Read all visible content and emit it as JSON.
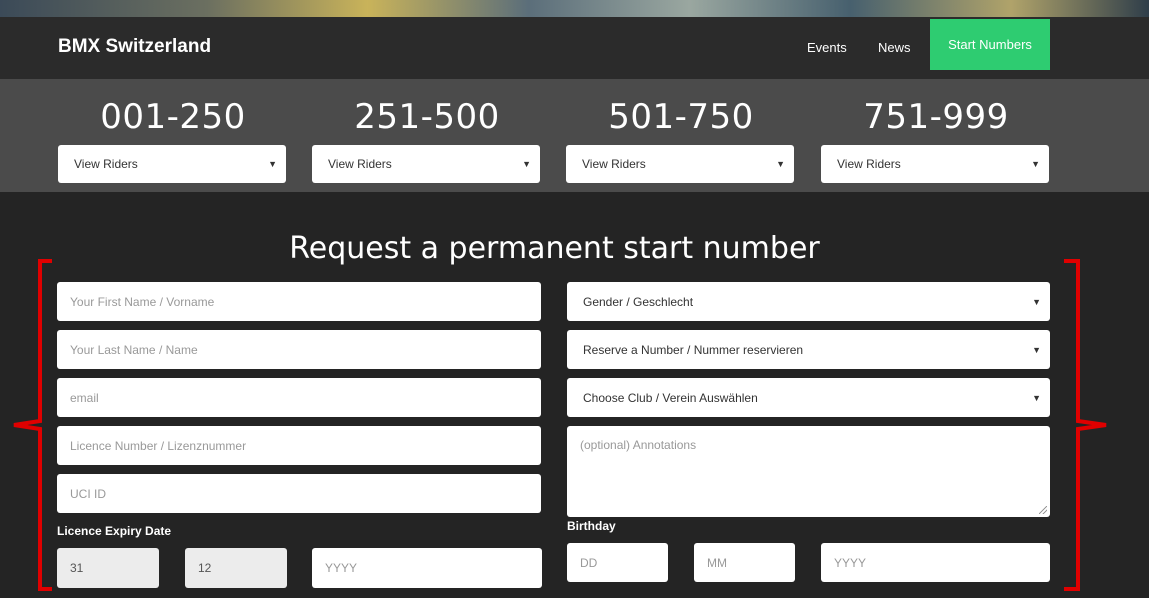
{
  "brand": "BMX Switzerland",
  "nav": {
    "events": "Events",
    "news": "News",
    "start_numbers": "Start Numbers"
  },
  "ranges": [
    {
      "title": "001-250",
      "select": "View Riders"
    },
    {
      "title": "251-500",
      "select": "View Riders"
    },
    {
      "title": "501-750",
      "select": "View Riders"
    },
    {
      "title": "751-999",
      "select": "View Riders"
    }
  ],
  "form": {
    "title": "Request a permanent start number",
    "first_name_placeholder": "Your First Name / Vorname",
    "last_name_placeholder": "Your Last Name / Name",
    "email_placeholder": "email",
    "licence_placeholder": "Licence Number / Lizenznummer",
    "uci_placeholder": "UCI ID",
    "gender_select": "Gender / Geschlecht",
    "reserve_select": "Reserve a Number / Nummer reservieren",
    "club_select": "Choose Club / Verein Auswählen",
    "annotations_placeholder": "(optional) Annotations",
    "licence_expiry_label": "Licence Expiry Date",
    "licence_day": "31",
    "licence_month": "12",
    "licence_year_placeholder": "YYYY",
    "birthday_label": "Birthday",
    "birth_day_placeholder": "DD",
    "birth_month_placeholder": "MM",
    "birth_year_placeholder": "YYYY"
  },
  "icons": {
    "caret": "caret-down-icon"
  },
  "colors": {
    "accent": "#2ecc71",
    "annotation": "#e00000"
  }
}
